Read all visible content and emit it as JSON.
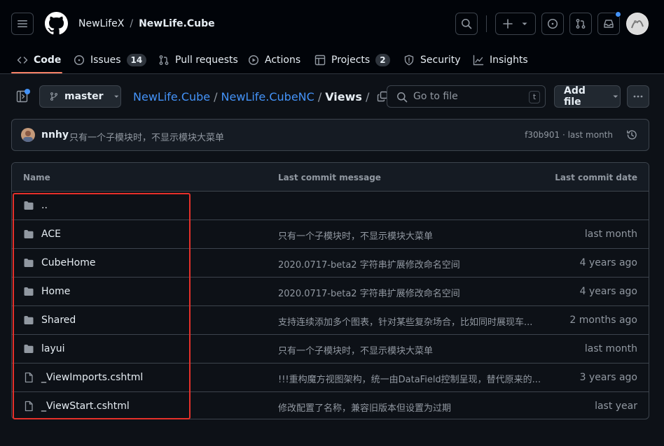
{
  "header": {
    "owner": "NewLifeX",
    "separator": "/",
    "repo": "NewLife.Cube"
  },
  "nav": {
    "tabs": [
      {
        "label": "Code",
        "icon": "code-icon"
      },
      {
        "label": "Issues",
        "icon": "issue-opened-icon",
        "count": "14"
      },
      {
        "label": "Pull requests",
        "icon": "git-pull-request-icon"
      },
      {
        "label": "Actions",
        "icon": "play-icon"
      },
      {
        "label": "Projects",
        "icon": "table-icon",
        "count": "2"
      },
      {
        "label": "Security",
        "icon": "shield-icon"
      },
      {
        "label": "Insights",
        "icon": "graph-icon"
      }
    ]
  },
  "toolbar": {
    "branch": "master",
    "path": [
      "NewLife.Cube",
      "NewLife.CubeNC",
      "Views"
    ],
    "path_sep": "/",
    "goto_placeholder": "Go to file",
    "goto_shortcut": "t",
    "add_file": "Add file"
  },
  "commit": {
    "author": "nnhy",
    "message": "只有一个子模块时，不显示模块大菜单",
    "meta": "f30b901 · last month"
  },
  "table": {
    "headers": [
      "Name",
      "Last commit message",
      "Last commit date"
    ],
    "rows": [
      {
        "type": "folder",
        "name": "..",
        "message": "",
        "date": ""
      },
      {
        "type": "folder",
        "name": "ACE",
        "message": "只有一个子模块时，不显示模块大菜单",
        "date": "last month"
      },
      {
        "type": "folder",
        "name": "CubeHome",
        "message": "2020.0717-beta2 字符串扩展修改命名空间",
        "date": "4 years ago"
      },
      {
        "type": "folder",
        "name": "Home",
        "message": "2020.0717-beta2 字符串扩展修改命名空间",
        "date": "4 years ago"
      },
      {
        "type": "folder",
        "name": "Shared",
        "message": "支持连续添加多个图表，针对某些复杂场合，比如同时展现车...",
        "date": "2 months ago"
      },
      {
        "type": "folder",
        "name": "layui",
        "message": "只有一个子模块时，不显示模块大菜单",
        "date": "last month"
      },
      {
        "type": "file",
        "name": "_ViewImports.cshtml",
        "message": "!!!重构魔方视图架构，统一由DataField控制呈现，替代原来的...",
        "date": "3 years ago"
      },
      {
        "type": "file",
        "name": "_ViewStart.cshtml",
        "message": "修改配置了名称，兼容旧版本但设置为过期",
        "date": "last year"
      }
    ]
  },
  "colors": {
    "background": "#0d1117",
    "header_bg": "#010409",
    "accent_link": "#4493f8",
    "underline": "#f78166",
    "highlight_box": "#e5302a"
  }
}
